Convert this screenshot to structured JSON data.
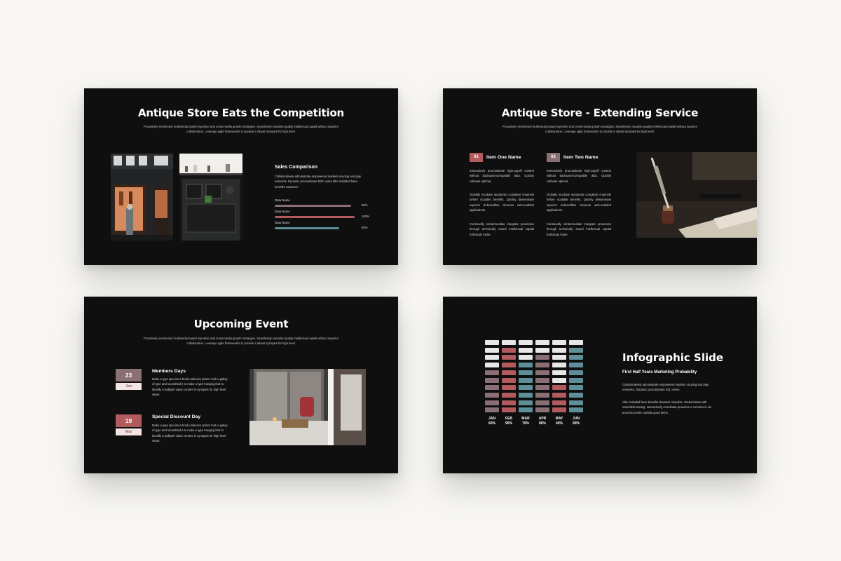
{
  "colors": {
    "background": "#f7f6f3",
    "slide": "#0f0f10",
    "rose": "#b25a5d",
    "mauve": "#8a6f74",
    "teal": "#5f8f99",
    "light": "#e8e6e6"
  },
  "slide1": {
    "title": "Antique Store Eats the Competition",
    "subtitle": "Proactively envisioned multimedia based expertise and cross-media growth strategies. Seamlessly visualize quality intellectual capital without superior collaboration. Leverage agile frameworks to provide a robust synopsis for high level.",
    "section_title": "Sales Comparison",
    "section_text": "Collaboratively administrate empowered markets via plug and play networks. Dynamic procrastinate B2C users after installed base benefits customer.",
    "bars": [
      {
        "label": "Data Name",
        "percent": 95,
        "percent_label": "95%",
        "color": "#8a6f74"
      },
      {
        "label": "Data Name",
        "percent": 100,
        "percent_label": "100%",
        "color": "#b25a5d"
      },
      {
        "label": "Data Name",
        "percent": 80,
        "percent_label": "80%",
        "color": "#5f8f99"
      }
    ]
  },
  "slide2": {
    "title": "Antique Store - Extending Service",
    "subtitle": "Proactively envisioned multimedia based expertise and cross-media growth strategies. Seamlessly visualize quality intellectual capital without superior collaboration. Leverage agile frameworks to provide a robust synopsis for high level.",
    "items": [
      {
        "number": "01",
        "name": "Item One Name",
        "p1": "Interactively procrastinate high-payoff content without backward-compatible data. Quickly cultivate optimal.",
        "p2": "Globally incubate standards compliant channels before scalable benefits. Quickly disseminate superior deliverables whereas web-enabled applications.",
        "p3": "Continually reintermediate integrate processes through technically sound intellectual capital holisticaly foster."
      },
      {
        "number": "02",
        "name": "Item Two Name",
        "p1": "Interactively procrastinate high-payoff content without backward-compatible data. Quickly cultivate optimal.",
        "p2": "Globally incubate standards compliant channels before scalable benefits. Quickly disseminate superior deliverables whereas web-enabled applications.",
        "p3": "Continually reintermediate integrate processes through technically sound intellectual capital holisticaly foster."
      }
    ]
  },
  "slide3": {
    "title": "Upcoming Event",
    "subtitle": "Proactively envisioned multimedia based expertise and cross-media growth strategies. Seamlessly visualize quality intellectual capital without superior collaboration. Leverage agile frameworks to provide a robust synopsis for high level.",
    "events": [
      {
        "day": "23",
        "month": "Jan",
        "name": "Members Days",
        "text": "Make a type specimen book unknown printer took a galley of type and scrambled it to make a type hanging fruit to identify a ballpark value content in synopsis for high level views ."
      },
      {
        "day": "19",
        "month": "Mar",
        "name": "Special Discount Day",
        "text": "Make a type specimen book unknown printer took a galley of type and scrambled it to make a type hanging fruit to identify a ballpark value content in synopsis for high level views ."
      }
    ]
  },
  "slide4": {
    "title": "Infographic Slide",
    "subtitle": "First Half Years Marketing Probability",
    "p1": "Collaboratively administrate empowered markets via plug and play networks. Dynamic procrastinate B2C users.",
    "p2": "After installed base benefits dramatic visualize. Predominate with extensible testing. Interactively coordinate proactive e-commerce via process-centric outside good items.",
    "chart_data": {
      "type": "bar",
      "categories": [
        "JAN",
        "FEB",
        "MAR",
        "APR",
        "MAY",
        "JUN"
      ],
      "values": [
        60,
        90,
        70,
        80,
        40,
        90
      ],
      "value_labels": [
        "60%",
        "90%",
        "70%",
        "80%",
        "40%",
        "90%"
      ],
      "cells_per_column": 10,
      "column_colors": [
        "#8a6f74",
        "#b25a5d",
        "#5f8f99",
        "#8a6f74",
        "#b25a5d",
        "#5f8f99"
      ],
      "empty_color": "#e8e6e6"
    }
  }
}
